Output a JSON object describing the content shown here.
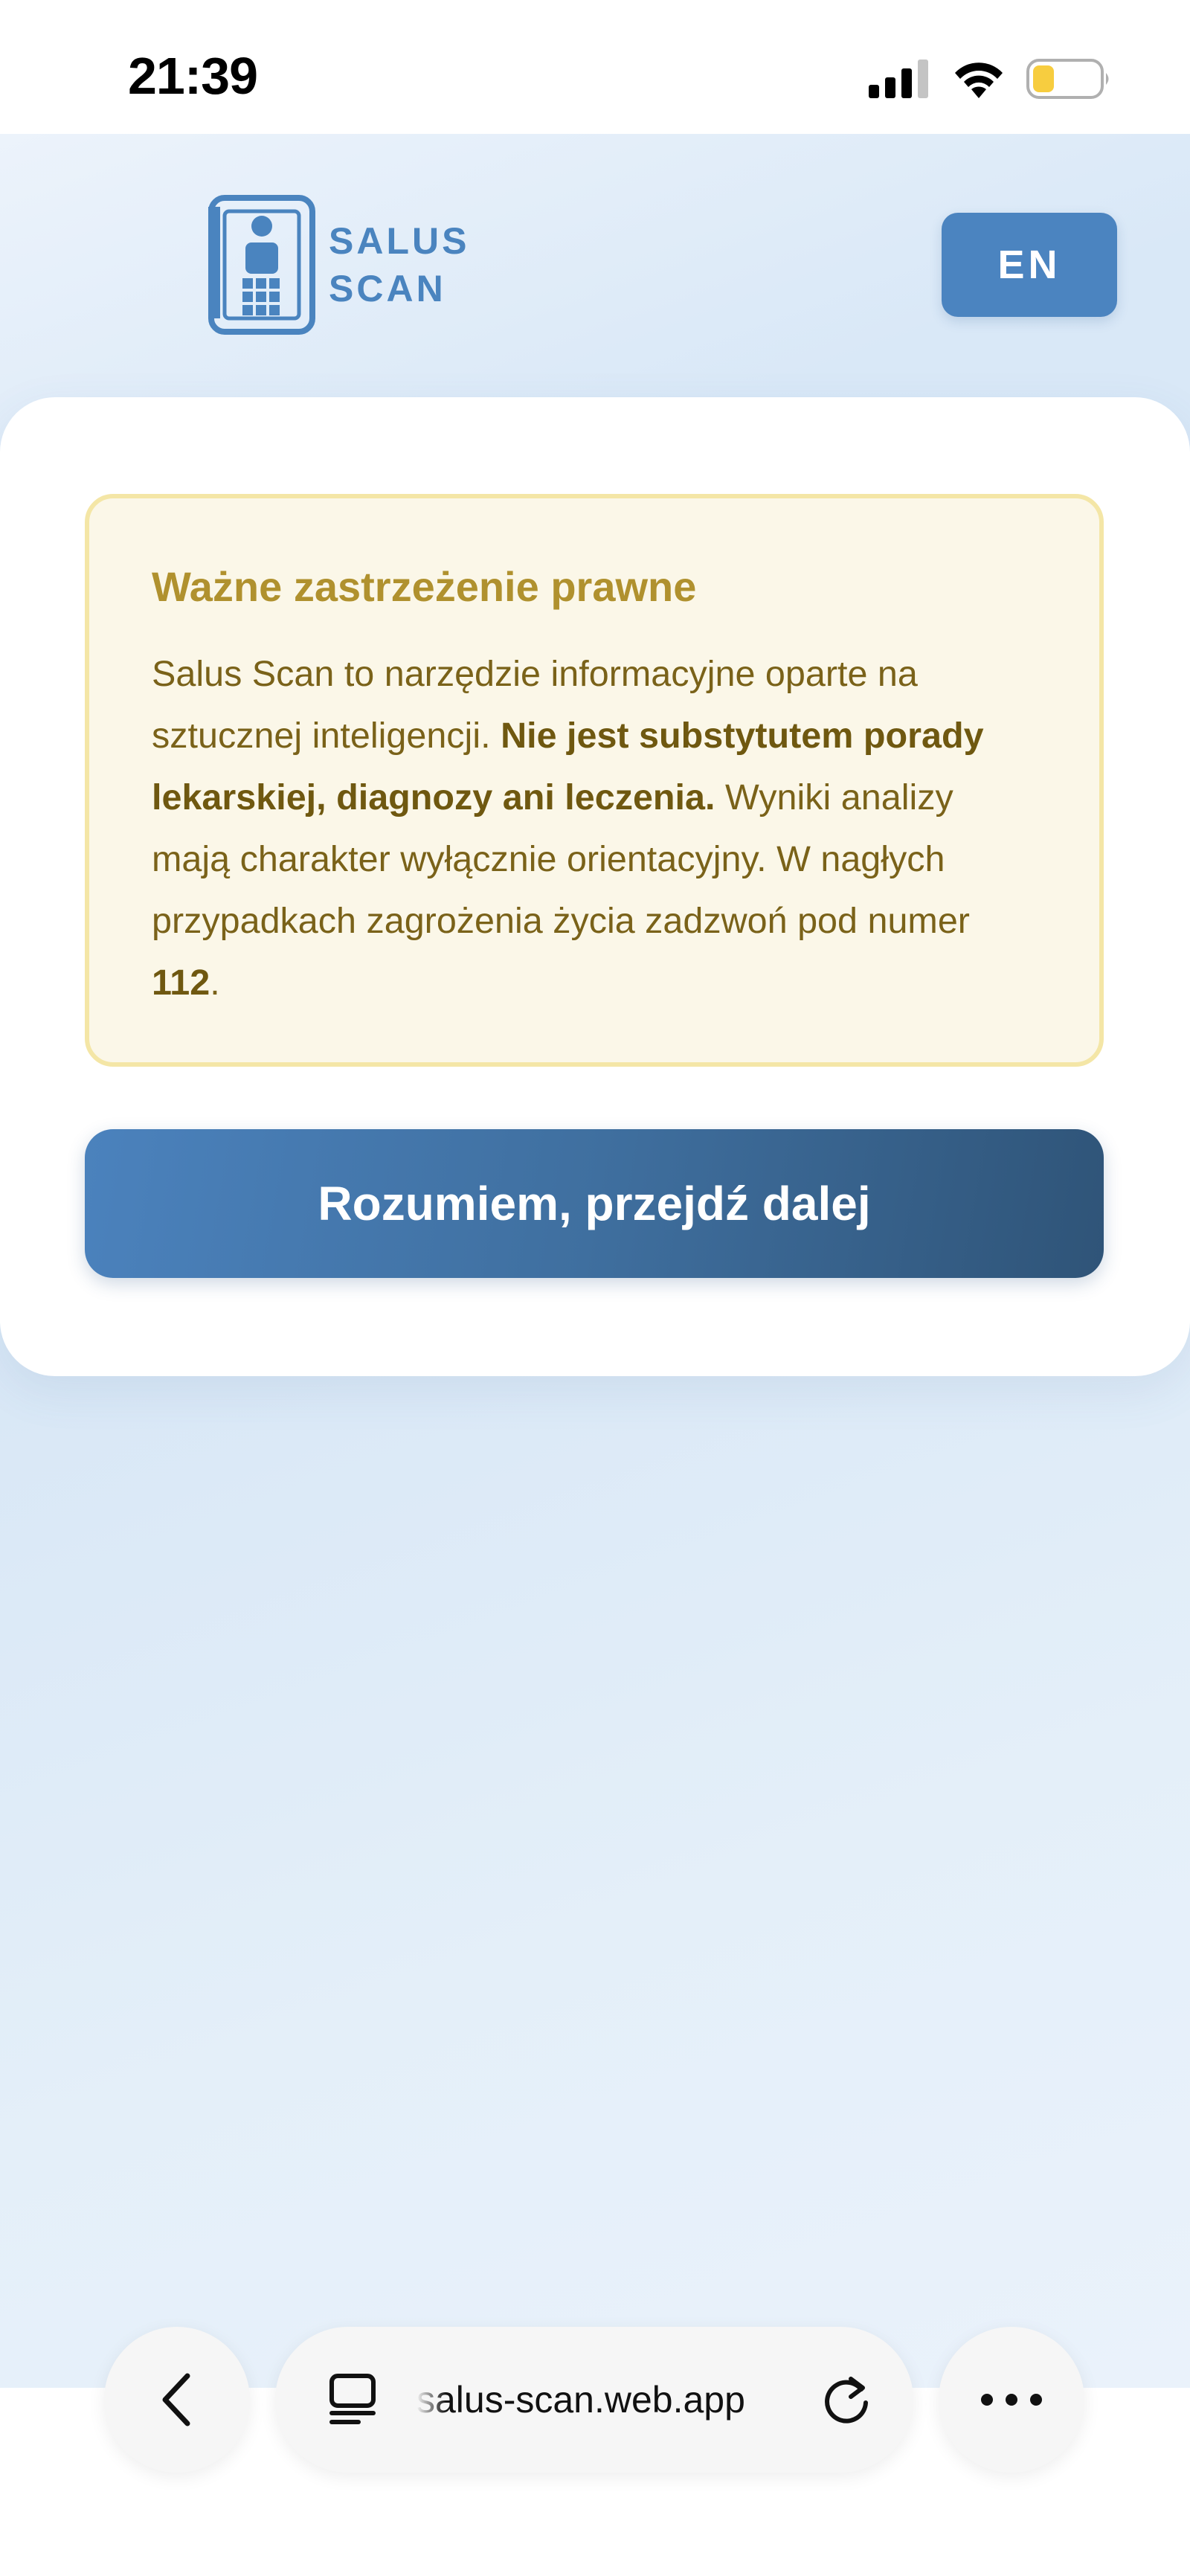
{
  "status_bar": {
    "time": "21:39",
    "signal_icon": "cellular-signal-icon",
    "wifi_icon": "wifi-icon",
    "battery_icon": "battery-low-icon"
  },
  "header": {
    "logo_line1": "SALUS",
    "logo_line2": "SCAN",
    "language_button": "EN"
  },
  "disclaimer": {
    "title": "Ważne zastrzeżenie prawne",
    "text_part1": "Salus Scan to narzędzie informacyjne oparte na sztucznej inteligencji. ",
    "text_bold": "Nie jest substytutem porady lekarskiej, diagnozy ani leczenia.",
    "text_part2": " Wyniki analizy mają charakter wyłącznie orientacyjny. W nagłych przypadkach zagrożenia życia zadzwoń pod numer ",
    "emergency_number": "112",
    "text_end": "."
  },
  "continue_button": "Rozumiem, przejdź dalej",
  "browser": {
    "url": "salus-scan.web.app",
    "back_icon": "chevron-left-icon",
    "tabs_icon": "tabs-icon",
    "reload_icon": "reload-icon",
    "more_icon": "more-dots-icon"
  },
  "colors": {
    "brand_blue": "#4b84c0",
    "warning_bg": "#fbf7e8",
    "warning_border": "#f4e6a6",
    "warning_title": "#b0912e",
    "warning_text": "#7a6219"
  }
}
